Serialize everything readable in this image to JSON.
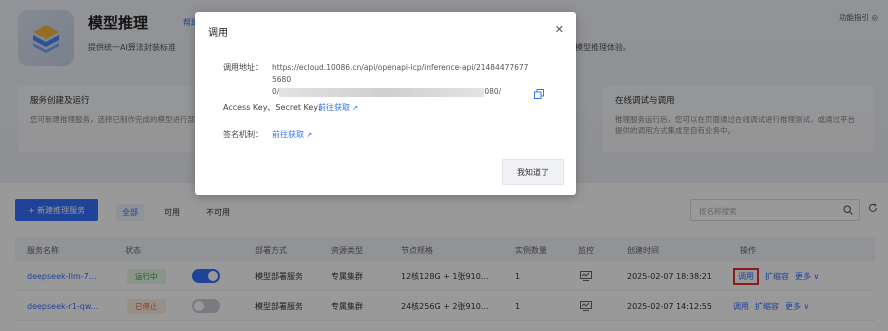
{
  "hero": {
    "title": "模型推理",
    "help_link": "帮助文档",
    "description": "提供统一AI算法封装标准",
    "description_right": "模型推理体验。",
    "guide": "功能指引"
  },
  "cards": [
    {
      "title": "服务创建及运行",
      "text": "您可新建推理服务，选择已制作完成的模型进行部署，成为在线服务实例。"
    },
    {
      "title": "在线调试与调用",
      "text": "推理服务运行后，您可以在页面通过在线调试进行推理测试，或通过平台提供的调用方式集成至自有业务中。"
    }
  ],
  "toolbar": {
    "new_button": "+ 新建推理服务",
    "filters": [
      "全部",
      "可用",
      "不可用"
    ],
    "search_placeholder": "按名称搜索"
  },
  "table": {
    "headers": [
      "服务名称",
      "状态",
      "部署方式",
      "资源类型",
      "节点规格",
      "实例数量",
      "监控",
      "创建时间",
      "操作"
    ],
    "rows": [
      {
        "name": "deepseek-llm-7...",
        "status": "运行中",
        "status_type": "running",
        "toggle": "on",
        "deploy": "模型部署服务",
        "resource": "专属集群",
        "spec": "12核128G + 1张910...",
        "count": "1",
        "created": "2025-02-07 18:38:21",
        "ops": [
          "调用",
          "扩缩容",
          "更多"
        ]
      },
      {
        "name": "deepseek-r1-qw...",
        "status": "已停止",
        "status_type": "stopped",
        "toggle": "off",
        "deploy": "模型部署服务",
        "resource": "专属集群",
        "spec": "24核256G + 2张910...",
        "count": "1",
        "created": "2025-02-07 14:12:55",
        "ops": [
          "调用",
          "扩缩容",
          "更多"
        ]
      }
    ]
  },
  "modal": {
    "title": "调用",
    "address_label": "调用地址：",
    "address_line1": "https://ecloud.10086.cn/api/openapi-icp/inference-api/214844776775680",
    "address_line2_prefix": "0/",
    "address_line2_suffix": "080/",
    "key_label": "Access Key、Secret Key：",
    "key_link": "前往获取",
    "sign_label": "签名机制：",
    "sign_link": "前往获取",
    "ok_button": "我知道了"
  },
  "colors": {
    "accent": "#3370ff",
    "highlight": "#e53030",
    "running": "#2fa52c",
    "stopped": "#e56b2b"
  }
}
